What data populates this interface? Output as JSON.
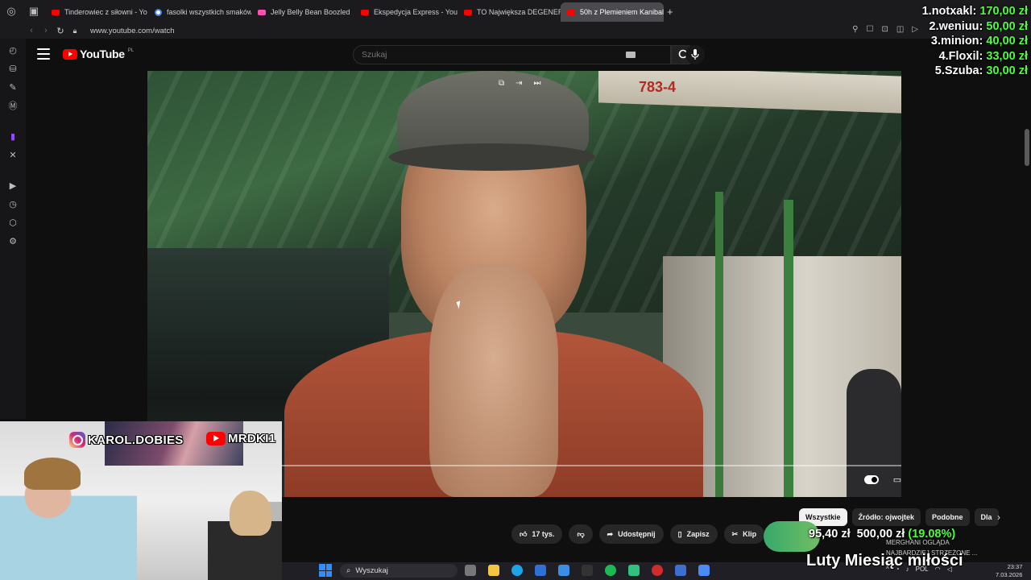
{
  "browser": {
    "tabs": [
      {
        "label": "Tinderowiec z siłowni - Yo",
        "favicon": "youtube-icon"
      },
      {
        "label": "fasolki wszystkich smaków",
        "favicon": "google-icon"
      },
      {
        "label": "Jelly Belly Bean Boozled",
        "favicon": "twitch-icon"
      },
      {
        "label": "Ekspedycja Express - You",
        "favicon": "youtube-icon"
      },
      {
        "label": "TO Największa DEGENERA",
        "favicon": "youtube-icon"
      },
      {
        "label": "50h z Plemieniem Kanibal",
        "favicon": "youtube-icon",
        "active": true
      }
    ],
    "url": "www.youtube.com/watch"
  },
  "youtube": {
    "logo_text": "YouTube",
    "region": "PL",
    "search_placeholder": "Szukaj",
    "video_sign_text": "783-4",
    "actions": {
      "likes": "17 tys.",
      "share": "Udostępnij",
      "save": "Zapisz",
      "clip": "Klip"
    },
    "chips": [
      "Wszystkie",
      "Źródło: ojwojtek",
      "Podobne",
      "Dla"
    ]
  },
  "leaderboard": [
    {
      "rank": "1.",
      "name": "notxakl:",
      "amount": "170,00 zł"
    },
    {
      "rank": "2.",
      "name": "weniuu:",
      "amount": "50,00 zł"
    },
    {
      "rank": "3.",
      "name": "minion:",
      "amount": "40,00 zł"
    },
    {
      "rank": "4.",
      "name": "Floxil:",
      "amount": "33,00 zł"
    },
    {
      "rank": "5.",
      "name": "Szuba:",
      "amount": "30,00 zł"
    }
  ],
  "webcam": {
    "instagram": "KAROL.DOBIES",
    "youtube": "MRDKI1"
  },
  "donation": {
    "current": "95,40 zł",
    "goal": "500,00 zł",
    "percent": "(19.08%)",
    "notification_line1": "MERGHANI OGLĄDA",
    "notification_line2": "NAJBARDZIEJ STRZEŻONE ..."
  },
  "overlay_text": "Luty Miesiąc miłości",
  "taskbar": {
    "search_label": "Wyszukaj",
    "lang": "POL",
    "time": "23:37",
    "date": "7.03.2026"
  },
  "colors": {
    "accent_green": "#4dff3a",
    "youtube_red": "#ff0000",
    "twitch_purple": "#9146ff"
  }
}
